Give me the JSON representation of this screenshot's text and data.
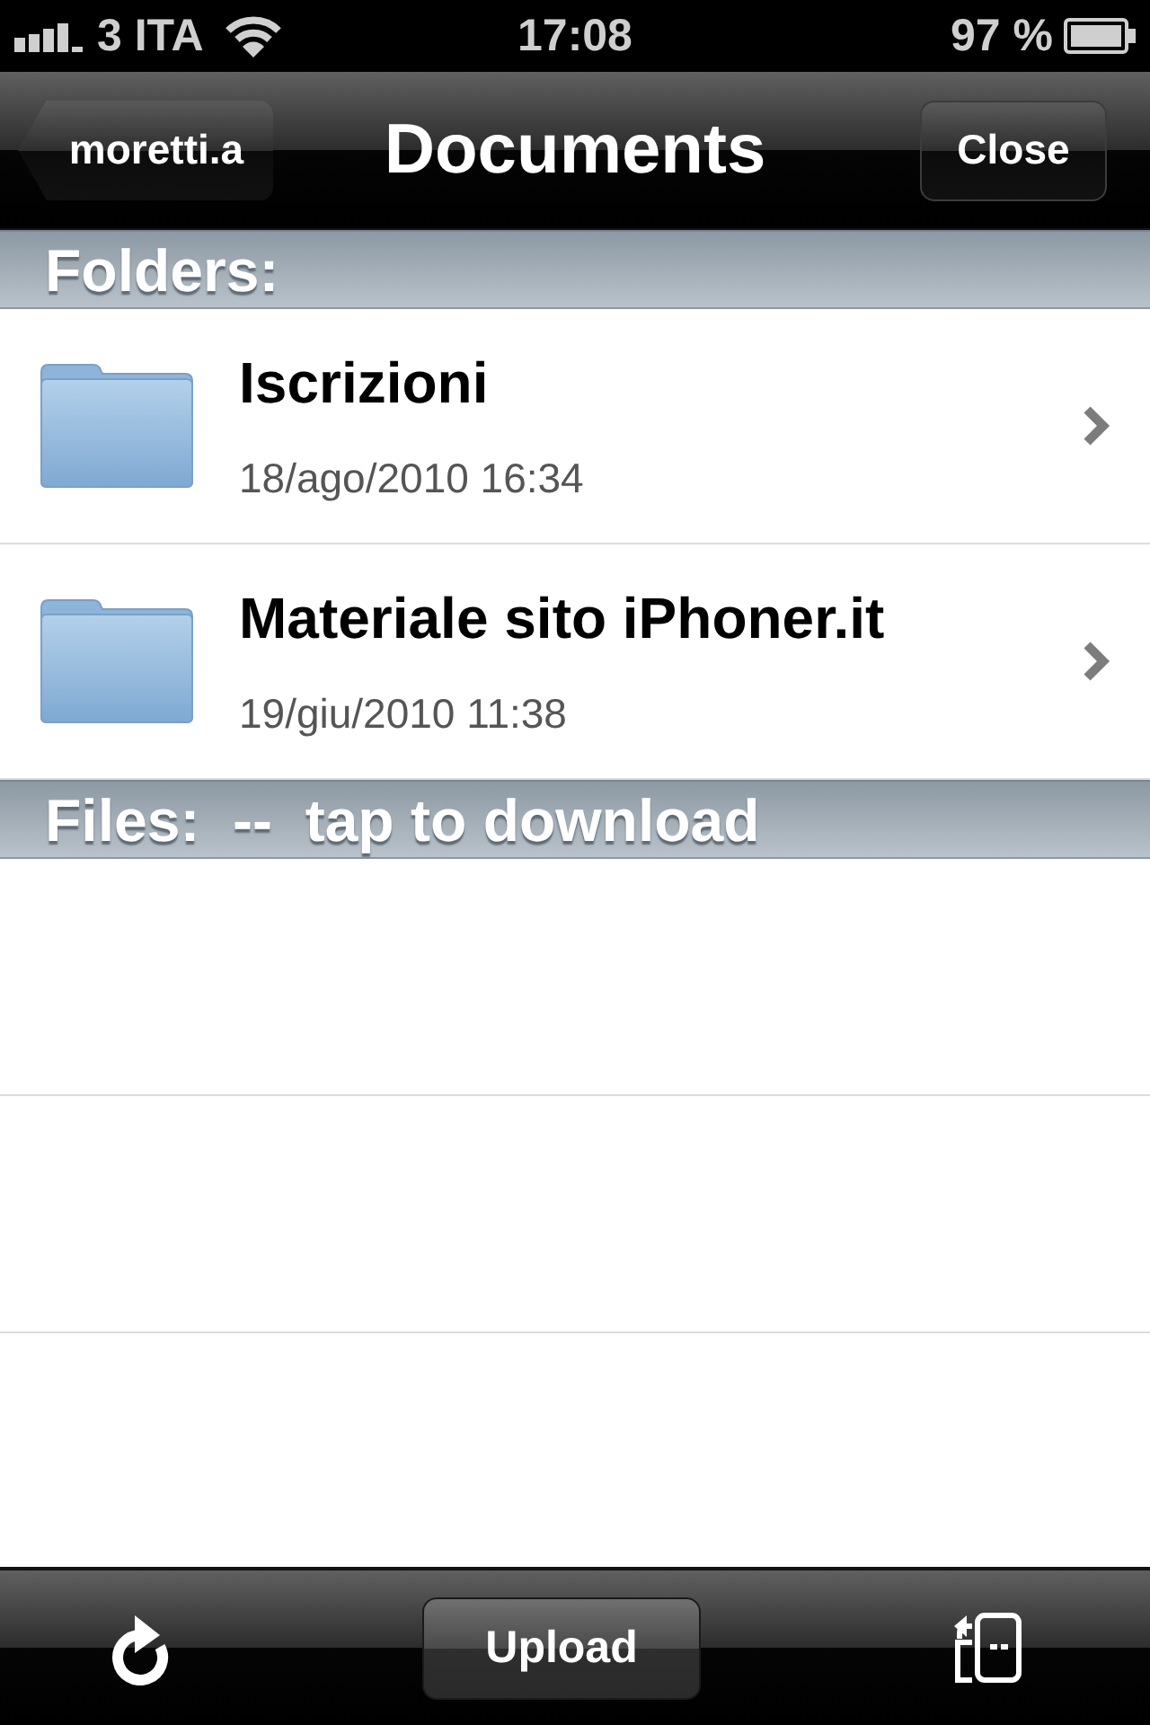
{
  "status_bar": {
    "carrier": "3 ITA",
    "time": "17:08",
    "battery": "97 %"
  },
  "nav_bar": {
    "back_button": "moretti.a",
    "title": "Documents",
    "close_button": "Close"
  },
  "sections": [
    {
      "header": "Folders:",
      "rows": [
        {
          "title": "Iscrizioni",
          "date": "18/ago/2010 16:34"
        },
        {
          "title": "Materiale sito iPhoner.it",
          "date": "19/giu/2010 11:38"
        }
      ]
    },
    {
      "header": "Files:  --  tap to download"
    }
  ],
  "toolbar": {
    "upload_button": "Upload"
  }
}
